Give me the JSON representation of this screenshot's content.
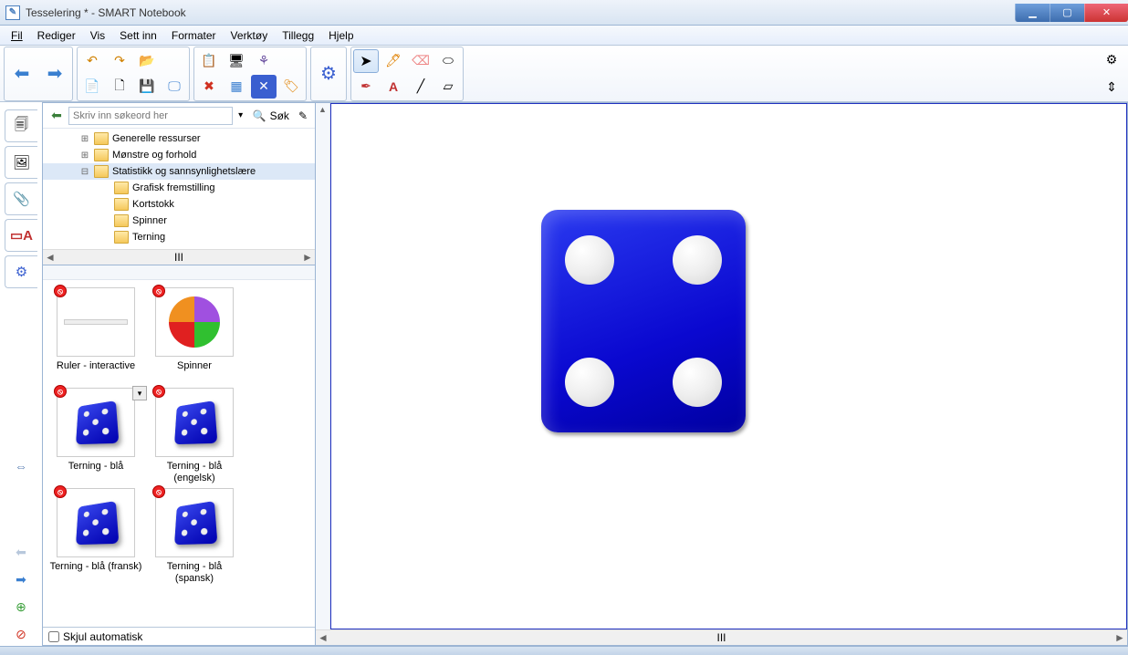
{
  "titlebar": {
    "title": "Tesselering * - SMART Notebook"
  },
  "menu": {
    "items": [
      "Fil",
      "Rediger",
      "Vis",
      "Sett inn",
      "Formater",
      "Verktøy",
      "Tillegg",
      "Hjelp"
    ]
  },
  "search": {
    "placeholder": "Skriv inn søkeord her",
    "button": "Søk"
  },
  "tree": {
    "items": [
      {
        "indent": 0,
        "expand": "⊞",
        "label": "Generelle ressurser"
      },
      {
        "indent": 0,
        "expand": "⊞",
        "label": "Mønstre og forhold"
      },
      {
        "indent": 0,
        "expand": "⊟",
        "label": "Statistikk og sannsynlighetslære",
        "selected": true
      },
      {
        "indent": 1,
        "expand": "",
        "label": "Grafisk fremstilling"
      },
      {
        "indent": 1,
        "expand": "",
        "label": "Kortstokk"
      },
      {
        "indent": 1,
        "expand": "",
        "label": "Spinner"
      },
      {
        "indent": 1,
        "expand": "",
        "label": "Terning"
      }
    ]
  },
  "thumbs": [
    {
      "label": "Ruler - interactive",
      "kind": "ruler"
    },
    {
      "label": "Spinner",
      "kind": "spinner"
    },
    {
      "label": "Terning - blå",
      "kind": "die",
      "hasDrop": true
    },
    {
      "label": "Terning - blå (engelsk)",
      "kind": "die"
    },
    {
      "label": "Terning - blå (fransk)",
      "kind": "die"
    },
    {
      "label": "Terning - blå (spansk)",
      "kind": "die"
    }
  ],
  "panel_bottom": {
    "checkbox_label": "Skjul automatisk"
  },
  "hscroll_center": "III",
  "tree_hscroll_center": "III"
}
